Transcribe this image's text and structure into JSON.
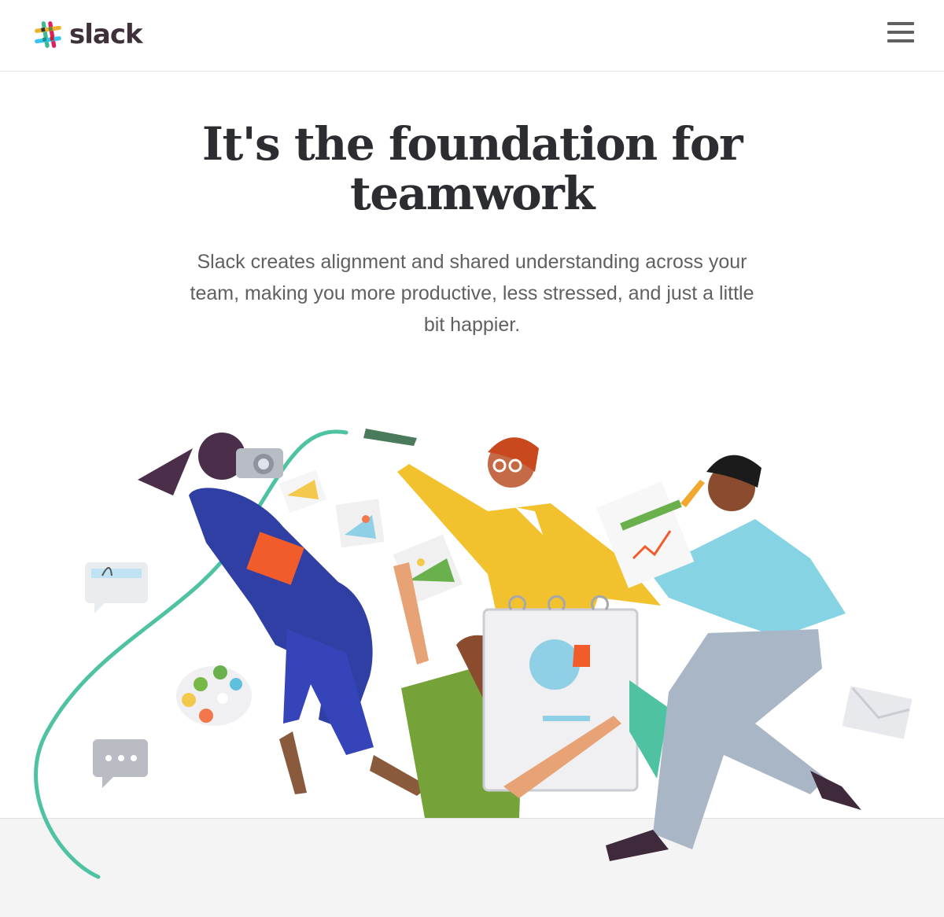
{
  "header": {
    "logo_text": "slack",
    "logo_icon": "slack-hash-logo",
    "menu_icon": "hamburger-menu-icon"
  },
  "hero": {
    "title": "It's the foundation for teamwork",
    "subtitle": "Slack creates alignment and shared understanding across your team, making you more productive, less stressed, and just a little bit happier."
  },
  "illustration": {
    "description_icons": [
      "camera-icon",
      "pencil-icon",
      "chart-icon",
      "calendar-icon",
      "paint-palette-icon",
      "chat-bubble-icon",
      "envelope-icon",
      "photo-icon"
    ]
  },
  "colors": {
    "text_dark": "#2c2d30",
    "text_muted": "#616061",
    "logo_text": "#3e313c",
    "footer_band": "#f4f4f4",
    "accent_green": "#3eb991",
    "accent_blue": "#36c5f0",
    "accent_red": "#e01e5a",
    "accent_yellow": "#ecb22e"
  }
}
